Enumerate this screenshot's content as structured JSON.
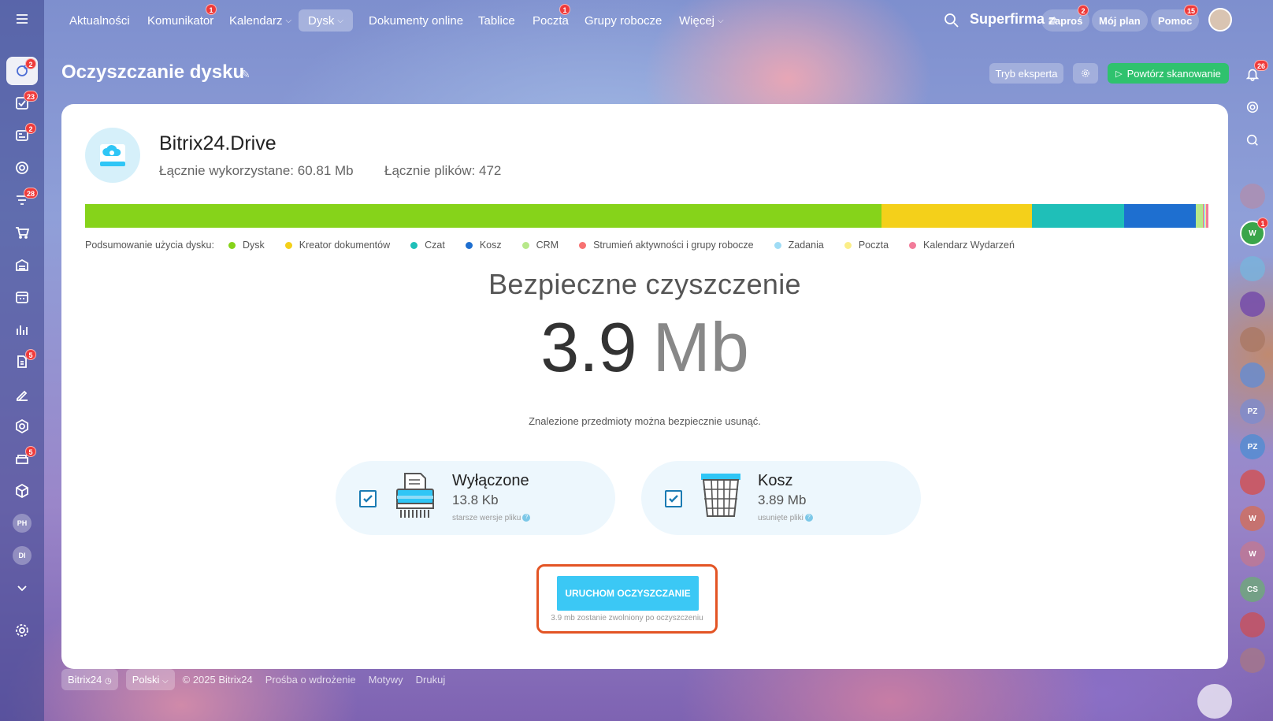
{
  "topnav": {
    "items": [
      {
        "label": "Aktualności",
        "badge": ""
      },
      {
        "label": "Komunikator",
        "badge": "1"
      },
      {
        "label": "Kalendarz",
        "badge": ""
      },
      {
        "label": "Dysk",
        "badge": ""
      },
      {
        "label": "Dokumenty online",
        "badge": ""
      },
      {
        "label": "Tablice",
        "badge": ""
      },
      {
        "label": "Poczta",
        "badge": "1"
      },
      {
        "label": "Grupy robocze",
        "badge": ""
      },
      {
        "label": "Więcej",
        "badge": ""
      }
    ],
    "company": "Superfirma",
    "invite_label": "Zaproś",
    "invite_badge": "2",
    "plan_label": "Mój plan",
    "help_label": "Pomoc",
    "help_badge": "15"
  },
  "sidebar": {
    "badges": {
      "feed": "2",
      "tasks": "23",
      "crm": "2",
      "funnel": "28",
      "docs": "5",
      "store": "5"
    },
    "avatars": [
      "PH",
      "DI"
    ]
  },
  "rightbar": {
    "notif_badge": "26",
    "w_badge": "1",
    "avatars": [
      "W",
      "PZ",
      "PZ",
      "W",
      "W",
      "CS"
    ]
  },
  "page": {
    "title": "Oczyszczanie dysku",
    "expert_mode": "Tryb eksperta",
    "rescan": "Powtórz skanowanie"
  },
  "drive": {
    "name": "Bitrix24.Drive",
    "used": "Łącznie wykorzystane: 60.81 Mb",
    "files": "Łącznie plików: 472"
  },
  "usage": {
    "legend_title": "Podsumowanie użycia dysku:",
    "segments": [
      {
        "name": "Dysk",
        "color": "#86d31a",
        "share": 0.709
      },
      {
        "name": "Kreator dokumentów",
        "color": "#f4d01a",
        "share": 0.134
      },
      {
        "name": "Czat",
        "color": "#1fbfb8",
        "share": 0.082
      },
      {
        "name": "Kosz",
        "color": "#1e6fd0",
        "share": 0.064
      },
      {
        "name": "CRM",
        "color": "#b7e88a",
        "share": 0.006
      },
      {
        "name": "Strumień aktywności i grupy robocze",
        "color": "#f77272",
        "share": 0.001
      },
      {
        "name": "Zadania",
        "color": "#9fdcf5",
        "share": 0.001
      },
      {
        "name": "Poczta",
        "color": "#fbee88",
        "share": 0.001
      },
      {
        "name": "Kalendarz Wydarzeń",
        "color": "#f27c9a",
        "share": 0.002
      }
    ]
  },
  "cleanup": {
    "title": "Bezpieczne czyszczenie",
    "size_value": "3.9",
    "size_unit": "Mb",
    "note": "Znalezione przedmioty można bezpiecznie usunąć.",
    "options": [
      {
        "title": "Wyłączone",
        "size": "13.8 Kb",
        "note": "starsze wersje pliku",
        "checked": true
      },
      {
        "title": "Kosz",
        "size": "3.89 Mb",
        "note": "usunięte pliki",
        "checked": true
      }
    ],
    "run_button": "URUCHOM OCZYSZCZANIE",
    "run_note": "3.9 mb zostanie zwolniony po oczyszczeniu"
  },
  "footer": {
    "brand": "Bitrix24",
    "language": "Polski",
    "copyright": "© 2025 Bitrix24",
    "links": [
      "Prośba o wdrożenie",
      "Motywy",
      "Drukuj"
    ]
  }
}
